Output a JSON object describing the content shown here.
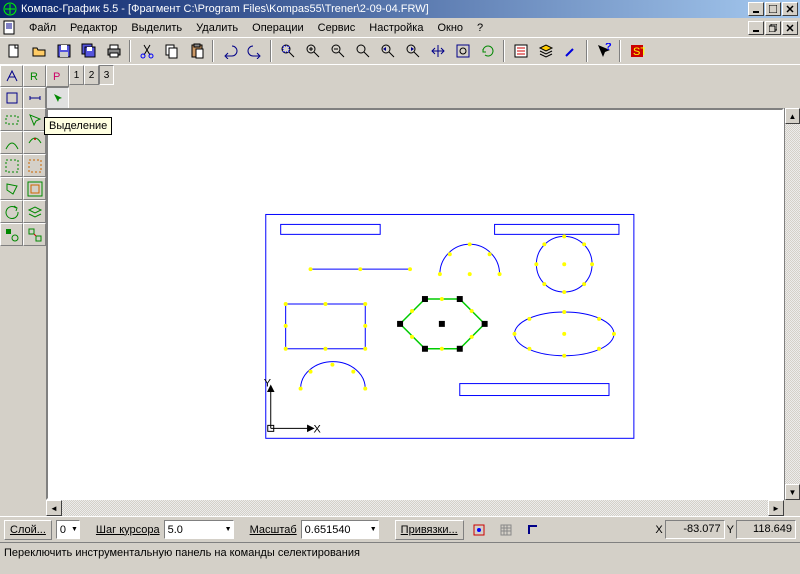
{
  "title": "Компас-График 5.5 - [Фрагмент C:\\Program Files\\Kompas55\\Trener\\2-09-04.FRW]",
  "menu": [
    "Файл",
    "Редактор",
    "Выделить",
    "Удалить",
    "Операции",
    "Сервис",
    "Настройка",
    "Окно",
    "?"
  ],
  "tooltip": "Выделение",
  "modes": {
    "nums": [
      "1",
      "2",
      "3"
    ]
  },
  "bottom": {
    "sloy_label": "Слой...",
    "sloy_val": "0",
    "step_label": "Шаг курсора",
    "step_val": "5.0",
    "scale_label": "Масштаб",
    "scale_val": "0.651540",
    "snap_label": "Привязки...",
    "x_label": "X",
    "x_val": "-83.077",
    "y_label": "Y",
    "y_val": "118.649"
  },
  "status": "Переключить инструментальную панель на команды селектирования"
}
